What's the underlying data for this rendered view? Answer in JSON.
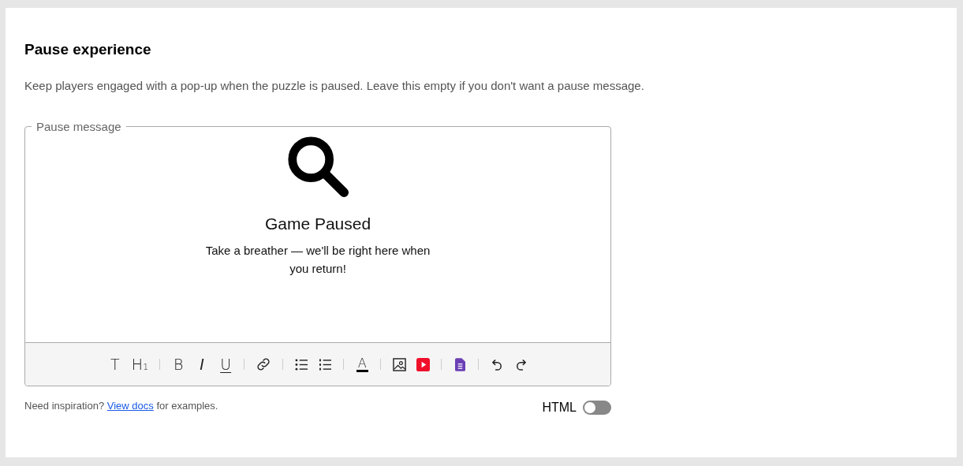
{
  "section": {
    "title": "Pause experience",
    "description": "Keep players engaged with a pop-up when the puzzle is paused. Leave this empty if you don't want a pause message."
  },
  "editor": {
    "legend": "Pause message",
    "content": {
      "heading": "Game Paused",
      "body": "Take a breather — we'll be right here when you return!"
    },
    "toolbar": [
      [
        {
          "kind": "text",
          "label": "T"
        },
        {
          "kind": "heading",
          "label": "H",
          "sub": "1"
        }
      ],
      [
        {
          "kind": "bold",
          "label": "B"
        },
        {
          "kind": "italic",
          "label": "I"
        },
        {
          "kind": "underline",
          "label": "U"
        }
      ],
      [
        {
          "kind": "link"
        }
      ],
      [
        {
          "kind": "bullets"
        },
        {
          "kind": "numbers"
        }
      ],
      [
        {
          "kind": "color",
          "label": "A"
        }
      ],
      [
        {
          "kind": "image"
        },
        {
          "kind": "video"
        }
      ],
      [
        {
          "kind": "form"
        }
      ],
      [
        {
          "kind": "undo"
        },
        {
          "kind": "redo"
        }
      ]
    ]
  },
  "hint": {
    "before": "Need inspiration?",
    "link": "View docs",
    "after": "for examples."
  },
  "html_toggle": {
    "label": "HTML",
    "on": false
  }
}
